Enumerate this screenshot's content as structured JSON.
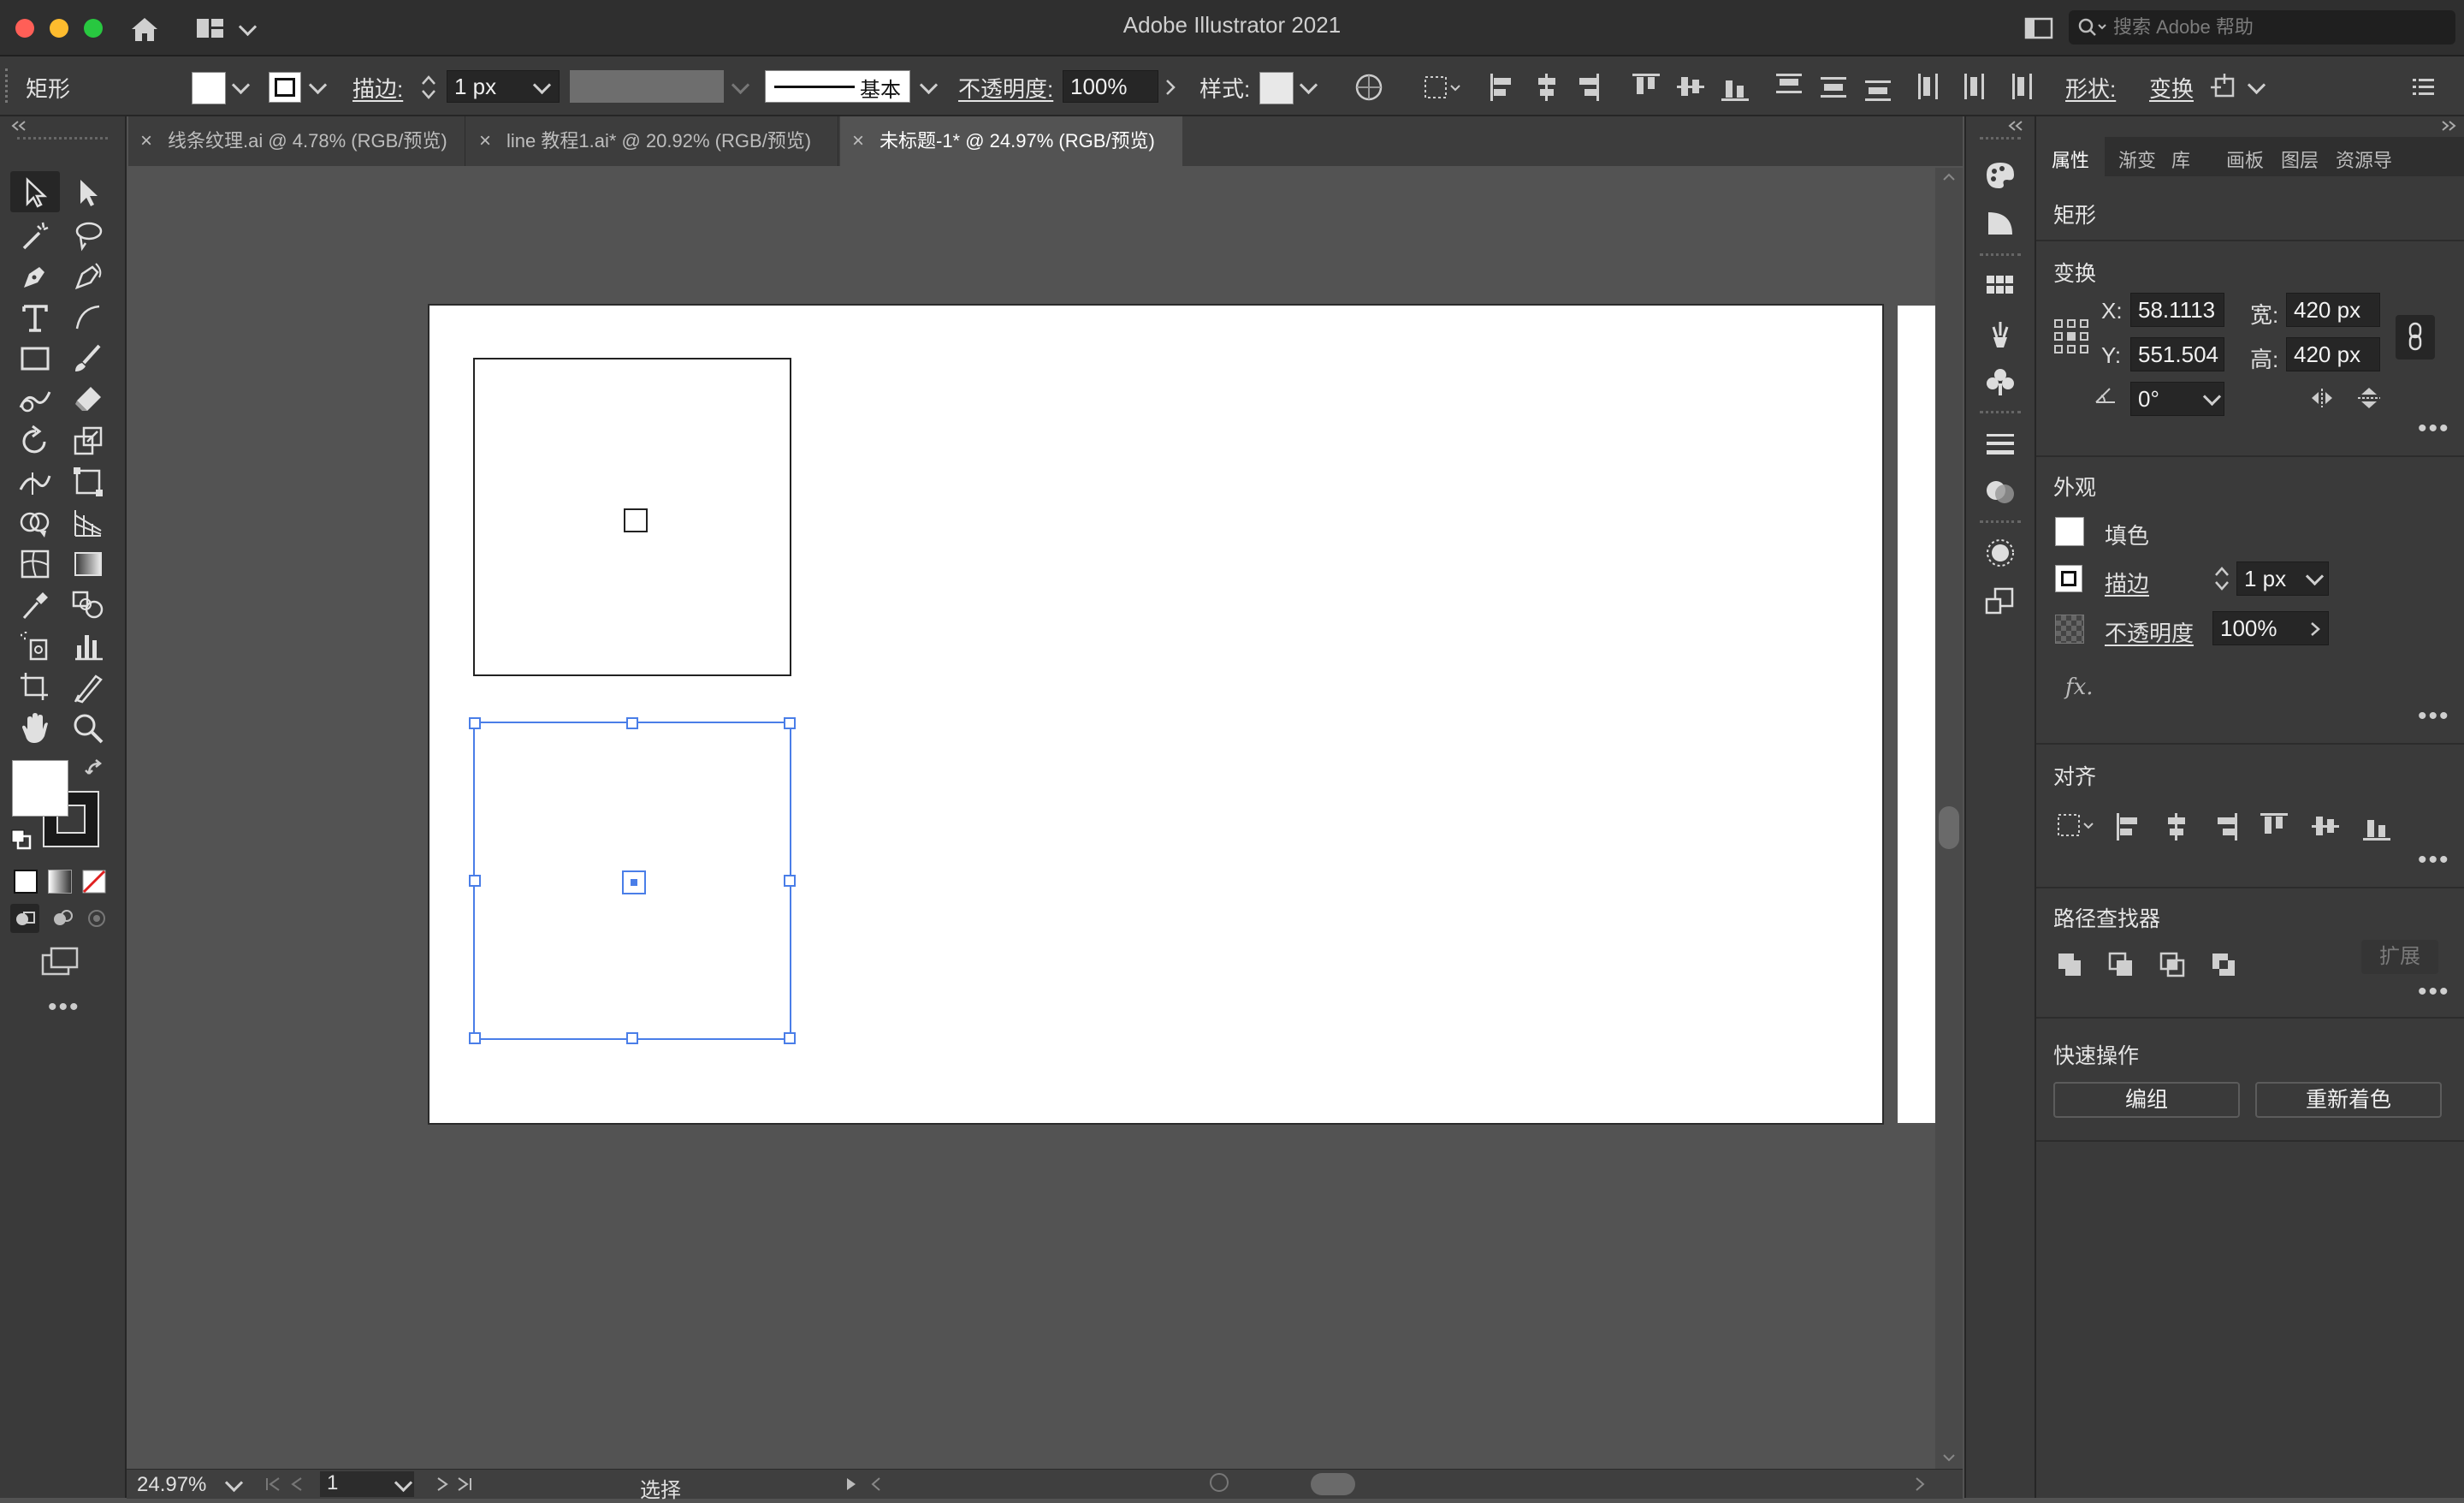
{
  "window": {
    "title": "Adobe Illustrator 2021",
    "search_placeholder": "搜索 Adobe 帮助"
  },
  "control_bar": {
    "object_type": "矩形",
    "stroke_label": "描边:",
    "stroke_weight": "1 px",
    "brush_label": "基本",
    "opacity_label": "不透明度:",
    "opacity_value": "100%",
    "style_label": "样式:",
    "shape_label": "形状:",
    "transform_label": "变换"
  },
  "tabs": [
    {
      "label": "线条纹理.ai @ 4.78% (RGB/预览)",
      "active": false
    },
    {
      "label": "line 教程1.ai* @ 20.92% (RGB/预览)",
      "active": false
    },
    {
      "label": "未标题-1* @ 24.97% (RGB/预览)",
      "active": true
    }
  ],
  "status_bar": {
    "zoom": "24.97%",
    "artboard_number": "1",
    "tool_status": "选择"
  },
  "properties_panel": {
    "tabs": [
      "属性",
      "渐变",
      "库",
      "画板",
      "图层",
      "资源导"
    ],
    "active_tab": "属性",
    "object_type": "矩形",
    "transform": {
      "title": "变换",
      "x_label": "X:",
      "x_value": "58.1113",
      "y_label": "Y:",
      "y_value": "551.504",
      "w_label": "宽:",
      "w_value": "420 px",
      "h_label": "高:",
      "h_value": "420 px",
      "rotate_value": "0°"
    },
    "appearance": {
      "title": "外观",
      "fill_label": "填色",
      "stroke_label": "描边",
      "stroke_value": "1 px",
      "opacity_label": "不透明度",
      "opacity_value": "100%",
      "fx_label": "fx."
    },
    "align": {
      "title": "对齐"
    },
    "pathfinder": {
      "title": "路径查找器",
      "expand_label": "扩展"
    },
    "quick_actions": {
      "title": "快速操作",
      "group_label": "编组",
      "recolor_label": "重新着色"
    }
  },
  "colors": {
    "selection": "#4a7ee8",
    "ui_dark": "#3a3a3a",
    "canvas": "#535353",
    "close": "#ff5f57",
    "minimize": "#febc2e",
    "zoom": "#28c840"
  }
}
